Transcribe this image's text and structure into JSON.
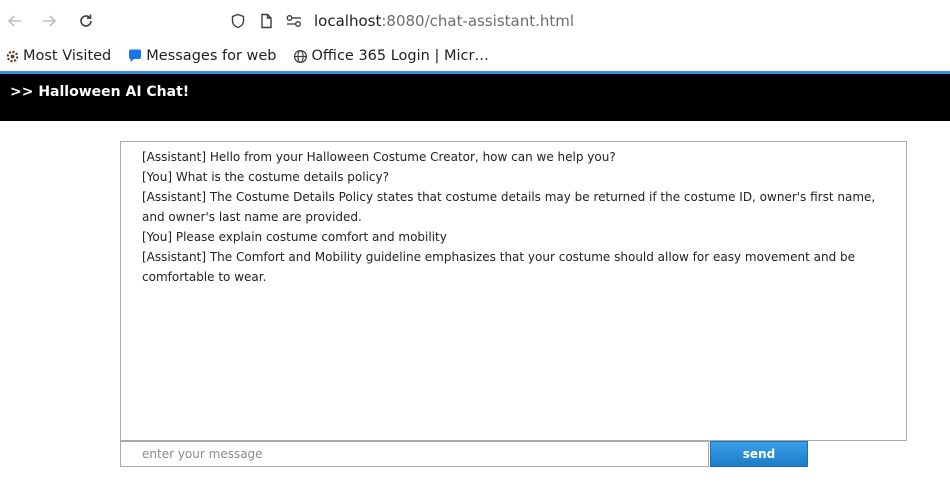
{
  "browser": {
    "url_host": "localhost",
    "url_rest": ":8080/chat-assistant.html",
    "icons": {
      "back": "arrow-left-icon",
      "forward": "arrow-right-icon",
      "reload": "reload-icon",
      "shield": "shield-icon",
      "page": "page-icon",
      "permissions": "permissions-icon"
    }
  },
  "bookmarks": [
    {
      "label": "Most Visited",
      "icon": "gear-icon"
    },
    {
      "label": "Messages for web",
      "icon": "messages-icon"
    },
    {
      "label": "Office 365 Login | Micr…",
      "icon": "globe-icon"
    }
  ],
  "page": {
    "title": ">> Halloween AI Chat!"
  },
  "chat": {
    "messages": [
      "[Assistant] Hello from your Halloween Costume Creator, how can we help you?",
      "[You] What is the costume details policy?",
      "[Assistant] The Costume Details Policy states that costume details may be returned if the costume ID, owner's first name, and owner's last name are provided.",
      "[You] Please explain costume comfort and mobility",
      "[Assistant] The Comfort and Mobility guideline emphasizes that your costume should allow for easy movement and be comfortable to wear."
    ],
    "input_placeholder": "enter your message",
    "input_value": "",
    "send_label": "send"
  },
  "colors": {
    "accent": "#3a8fd6",
    "header_bg": "#000000",
    "send_button": "#1d7cc9"
  }
}
